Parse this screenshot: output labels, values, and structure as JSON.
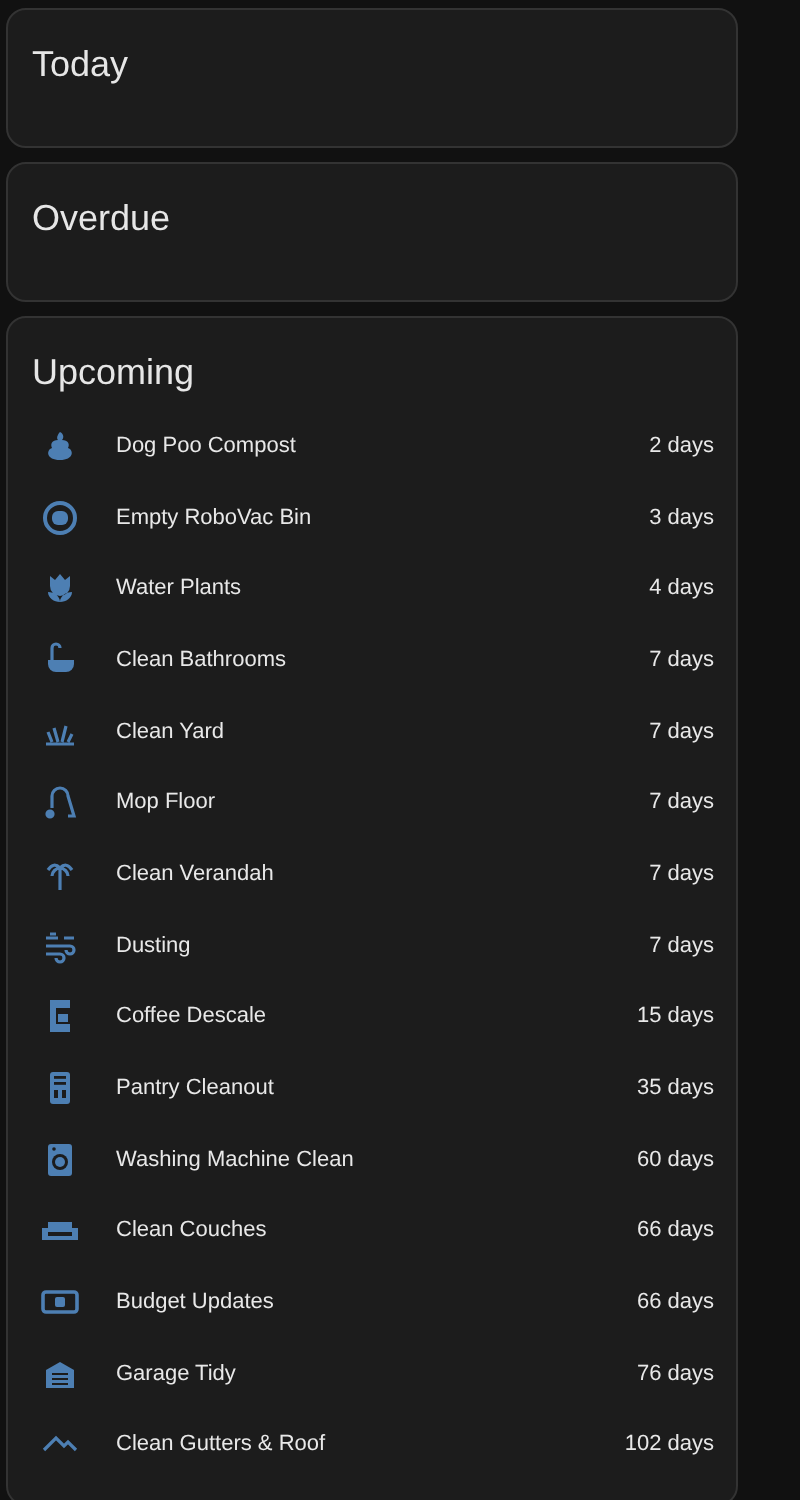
{
  "sections": [
    {
      "title": "Today"
    },
    {
      "title": "Overdue"
    },
    {
      "title": "Upcoming",
      "items": [
        {
          "name": "Dog Poo Compost",
          "due": "2 days"
        },
        {
          "name": "Empty RoboVac Bin",
          "due": "3 days"
        },
        {
          "name": "Water Plants",
          "due": "4 days"
        },
        {
          "name": "Clean Bathrooms",
          "due": "7 days"
        },
        {
          "name": "Clean Yard",
          "due": "7 days"
        },
        {
          "name": "Mop Floor",
          "due": "7 days"
        },
        {
          "name": "Clean Verandah",
          "due": "7 days"
        },
        {
          "name": "Dusting",
          "due": "7 days"
        },
        {
          "name": "Coffee Descale",
          "due": "15 days"
        },
        {
          "name": "Pantry Cleanout",
          "due": "35 days"
        },
        {
          "name": "Washing Machine Clean",
          "due": "60 days"
        },
        {
          "name": "Clean Couches",
          "due": "66 days"
        },
        {
          "name": "Budget Updates",
          "due": "66 days"
        },
        {
          "name": "Garage Tidy",
          "due": "76 days"
        },
        {
          "name": "Clean Gutters & Roof",
          "due": "102 days"
        }
      ]
    }
  ]
}
